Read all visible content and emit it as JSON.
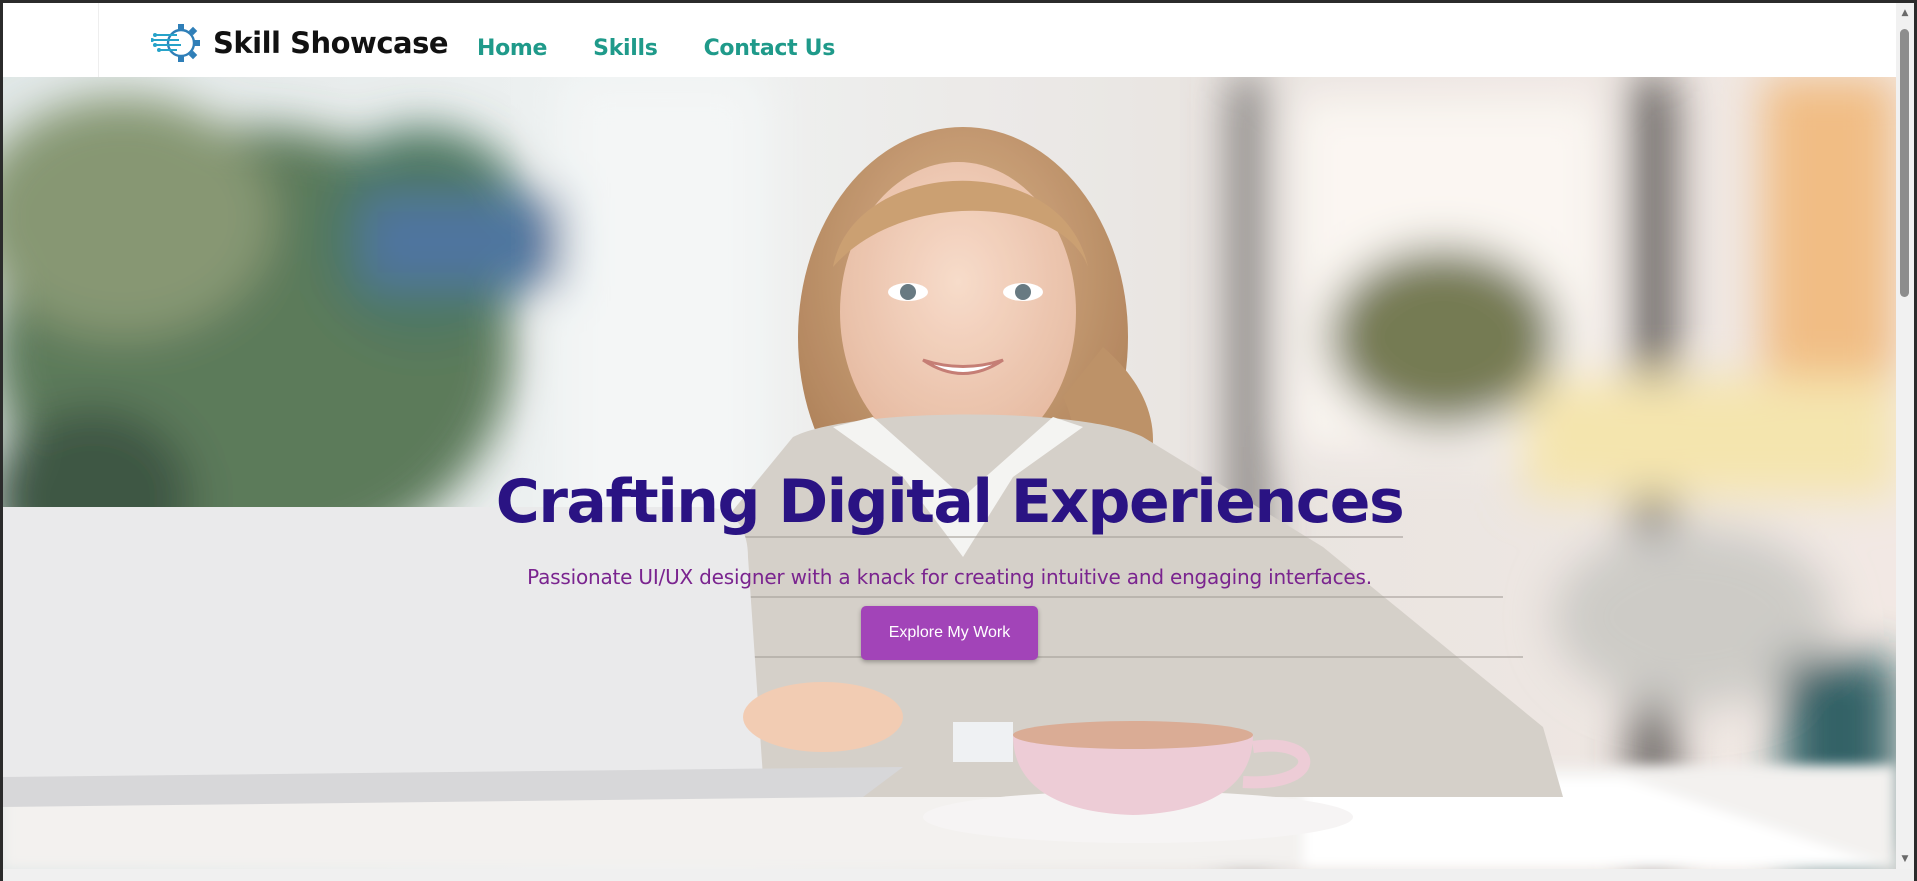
{
  "brand": {
    "name": "Skill Showcase",
    "logo_icon": "gear-circuit-icon"
  },
  "nav": {
    "items": [
      {
        "label": "Home"
      },
      {
        "label": "Skills"
      },
      {
        "label": "Contact Us"
      }
    ]
  },
  "hero": {
    "title": "Crafting Digital Experiences",
    "subtitle": "Passionate UI/UX designer with a knack for creating intuitive and engaging interfaces.",
    "cta_label": "Explore My Work",
    "background_image": "woman-smiling-at-laptop-in-cafe"
  },
  "colors": {
    "nav_link": "#1f9a8a",
    "hero_title": "#2a1383",
    "hero_subtitle": "#7a248f",
    "cta_background": "#a244b8",
    "brand_name": "#111111"
  }
}
